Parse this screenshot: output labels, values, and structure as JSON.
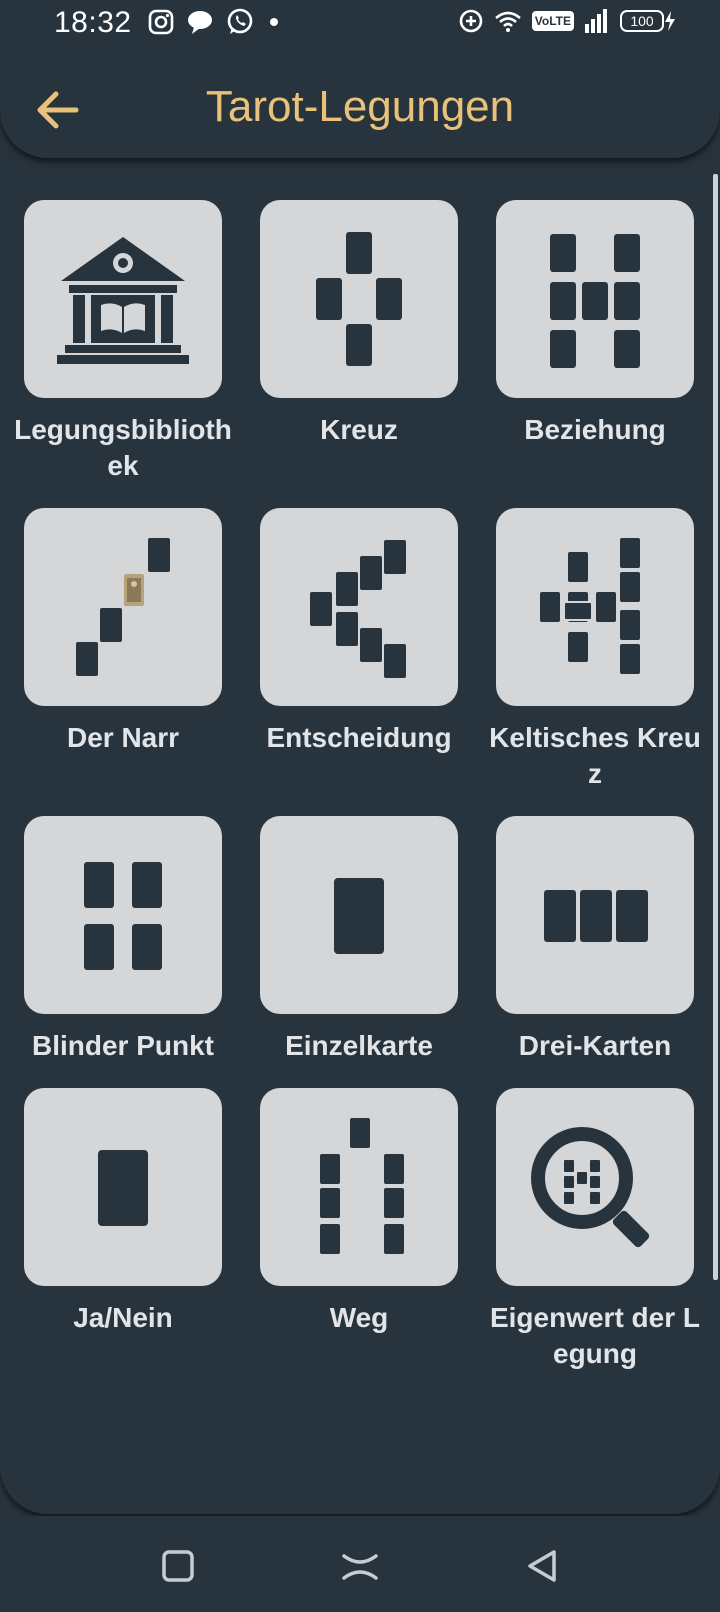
{
  "status": {
    "time": "18:32",
    "volte": "VoLTE",
    "battery": "100"
  },
  "header": {
    "title": "Tarot-Legungen",
    "back_icon": "arrow-left-icon",
    "accent_color": "#e8c27a"
  },
  "tiles": [
    {
      "label": "Legungsbibliothek",
      "icon": "library-icon"
    },
    {
      "label": "Kreuz",
      "icon": "cross-spread-icon"
    },
    {
      "label": "Beziehung",
      "icon": "relationship-spread-icon"
    },
    {
      "label": "Der Narr",
      "icon": "fool-spread-icon"
    },
    {
      "label": "Entscheidung",
      "icon": "decision-spread-icon"
    },
    {
      "label": "Keltisches Kreuz",
      "icon": "celtic-cross-spread-icon"
    },
    {
      "label": "Blinder Punkt",
      "icon": "blind-spot-spread-icon"
    },
    {
      "label": "Einzelkarte",
      "icon": "single-card-icon"
    },
    {
      "label": "Drei-Karten",
      "icon": "three-cards-icon"
    },
    {
      "label": "Ja/Nein",
      "icon": "yes-no-card-icon"
    },
    {
      "label": "Weg",
      "icon": "path-spread-icon"
    },
    {
      "label": "Eigenwert der Legung",
      "icon": "magnifier-spread-icon"
    }
  ],
  "colors": {
    "background": "#27343e",
    "tile": "#d4d6d8",
    "card": "#27343e",
    "label": "#e2e5e8"
  }
}
